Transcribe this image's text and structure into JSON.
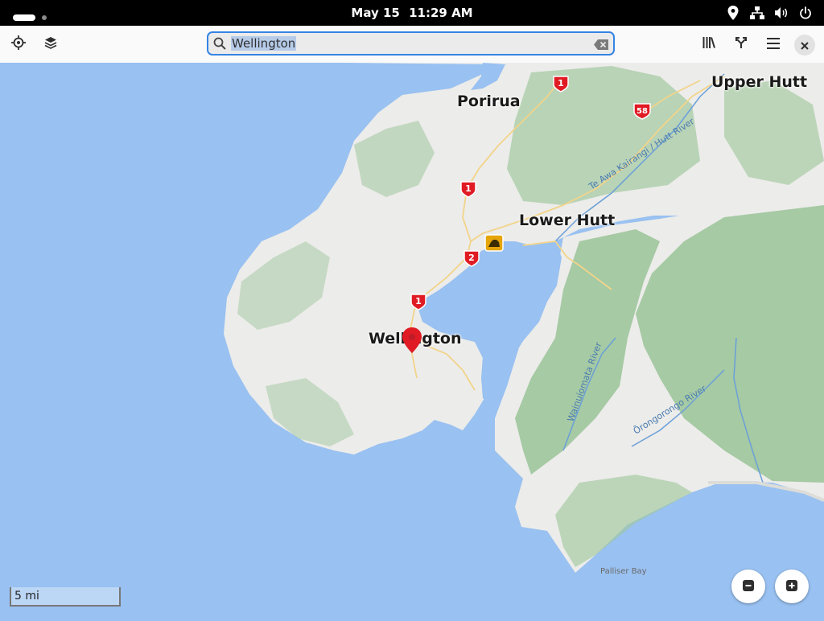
{
  "topbar": {
    "date": "May 15",
    "time": "11:29 AM"
  },
  "header": {
    "locate_icon": "crosshair-icon",
    "layers_icon": "layers-icon",
    "search_value": "Wellington",
    "search_icon": "search-icon",
    "clear_icon": "clear-icon",
    "bookmarks_icon": "library-icon",
    "route_icon": "route-icon",
    "menu_icon": "hamburger-icon",
    "close_icon": "close-icon"
  },
  "map": {
    "places": [
      "Porirua",
      "Upper Hutt",
      "Lower Hutt",
      "Wellington"
    ],
    "rivers": [
      "Te Awa Kairangi / Hutt River",
      "Wainuiomata River",
      "Ōrongorongo River"
    ],
    "bay": "Palliser Bay",
    "route_shields": [
      "1",
      "58",
      "1",
      "2",
      "1"
    ],
    "marker": "Wellington",
    "scale": "5 mi"
  },
  "colors": {
    "water": "#99c1f1",
    "land": "#ececea",
    "forest": "#9fc79c",
    "highway": "#e01b24"
  }
}
